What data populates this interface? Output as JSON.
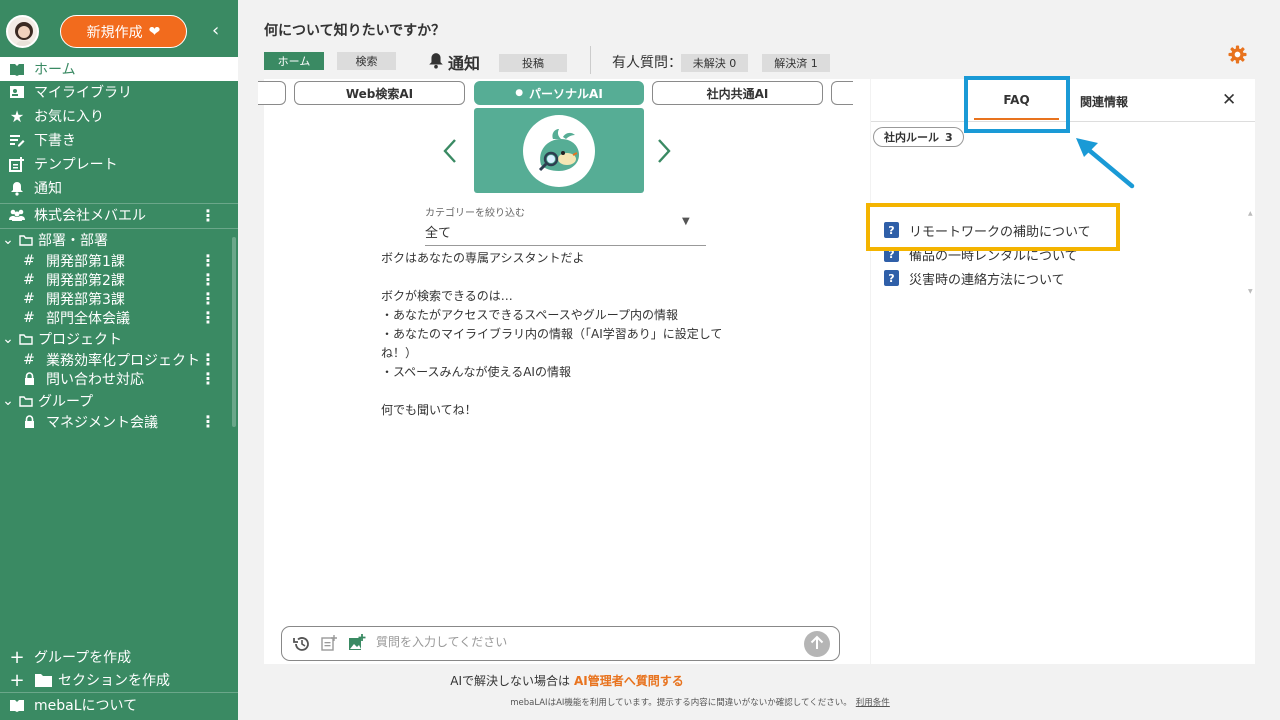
{
  "sidebar": {
    "new_button": "新規作成",
    "nav": [
      {
        "label": "ホーム",
        "icon": "book-icon"
      },
      {
        "label": "マイライブラリ",
        "icon": "library-icon"
      },
      {
        "label": "お気に入り",
        "icon": "star-icon"
      },
      {
        "label": "下書き",
        "icon": "draft-icon"
      },
      {
        "label": "テンプレート",
        "icon": "template-icon"
      },
      {
        "label": "通知",
        "icon": "bell-icon"
      }
    ],
    "company": "株式会社メバエル",
    "sections": [
      {
        "label": "部署・部署",
        "items": [
          "開発部第1課",
          "開発部第2課",
          "開発部第3課",
          "部門全体会議"
        ]
      },
      {
        "label": "プロジェクト",
        "items": [
          "業務効率化プロジェクト",
          "問い合わせ対応"
        ]
      },
      {
        "label": "グループ",
        "items": [
          "マネジメント会議"
        ]
      }
    ],
    "create_group": "グループを作成",
    "create_section": "セクションを作成",
    "about": "mebaLについて"
  },
  "header": {
    "question": "何について知りたいですか？",
    "home": "ホーム",
    "search": "検索",
    "notify": "通知",
    "post": "投稿",
    "human_question": "有人質問：",
    "unsolved": "未解決 0",
    "solved": "解決済 1"
  },
  "ai_tabs": [
    "Web検索AI",
    "パーソナルAI",
    "社内共通AI"
  ],
  "category": {
    "label": "カテゴリーを絞り込む",
    "value": "全て"
  },
  "bot_message": "ボクはあなたの専属アシスタントだよ\n\nボクが検索できるのは…\n・あなたがアクセスできるスペースやグループ内の情報\n・あなたのマイライブラリ内の情報（「AI学習あり」に設定してね！）\n・スペースみんなが使えるAIの情報\n\n何でも聞いてね！",
  "input": {
    "placeholder": "質問を入力してください"
  },
  "footer": {
    "line1": "AIで解決しない場合は",
    "line1_link": "AI管理者へ質問する",
    "line2": "mebaLAIはAI機能を利用しています。提示する内容に間違いがないか確認してください。",
    "terms": "利用条件"
  },
  "right_panel": {
    "tab_faq": "FAQ",
    "tab_related": "関連情報",
    "rule_chip": "社内ルール",
    "rule_count": "3",
    "faq_items": [
      "リモートワークの補助について",
      "備品の一時レンタルについて",
      "災害時の連絡方法について"
    ]
  },
  "colors": {
    "brand_green": "#3a8a63",
    "accent_orange": "#f26b1d",
    "teal": "#56ad95",
    "annotation_blue": "#1a9ad6",
    "annotation_yellow": "#f4b400"
  }
}
